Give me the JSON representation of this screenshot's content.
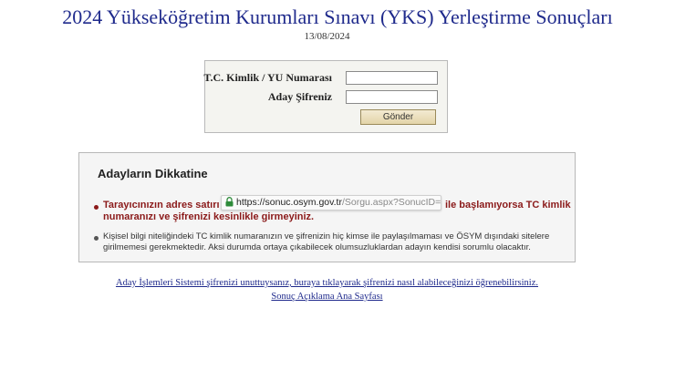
{
  "header": {
    "title": "2024 Yükseköğretim Kurumları Sınavı (YKS) Yerleştirme Sonuçları",
    "date": "13/08/2024"
  },
  "login": {
    "id_label": "T.C. Kimlik / YU Numarası",
    "id_value": "",
    "password_label": "Aday Şifreniz",
    "password_value": "",
    "submit_label": "Gönder"
  },
  "notice": {
    "title": "Adayların Dikkatine",
    "warning_part1": "Tarayıcınızın adres satırı",
    "warning_part2": "ile başlamıyorsa TC kimlik",
    "warning_line2": "numaranızı ve şifrenizi kesinlikle girmeyiniz.",
    "url_host": "https://sonuc.osym.gov.tr",
    "url_path": "/Sorgu.aspx?SonucID=",
    "lock_icon": "lock-icon",
    "privacy_note": "Kişisel bilgi niteliğindeki TC kimlik numaranızın ve şifrenizin hiç kimse ile paylaşılmaması ve ÖSYM dışındaki sitelere girilmemesi gerekmektedir. Aksi durumda ortaya çıkabilecek olumsuzluklardan adayın kendisi sorumlu olacaktır."
  },
  "links": {
    "forgot_password": "Aday İşlemleri Sistemi şifrenizi unuttuysanız, buraya tıklayarak şifrenizi nasıl alabileceğinizi öğrenebilirsiniz.",
    "results_home": "Sonuç Açıklama Ana Sayfası"
  },
  "colors": {
    "title": "#1f2a8c",
    "warning": "#8b1a1a",
    "lock": "#2e8b3a"
  }
}
